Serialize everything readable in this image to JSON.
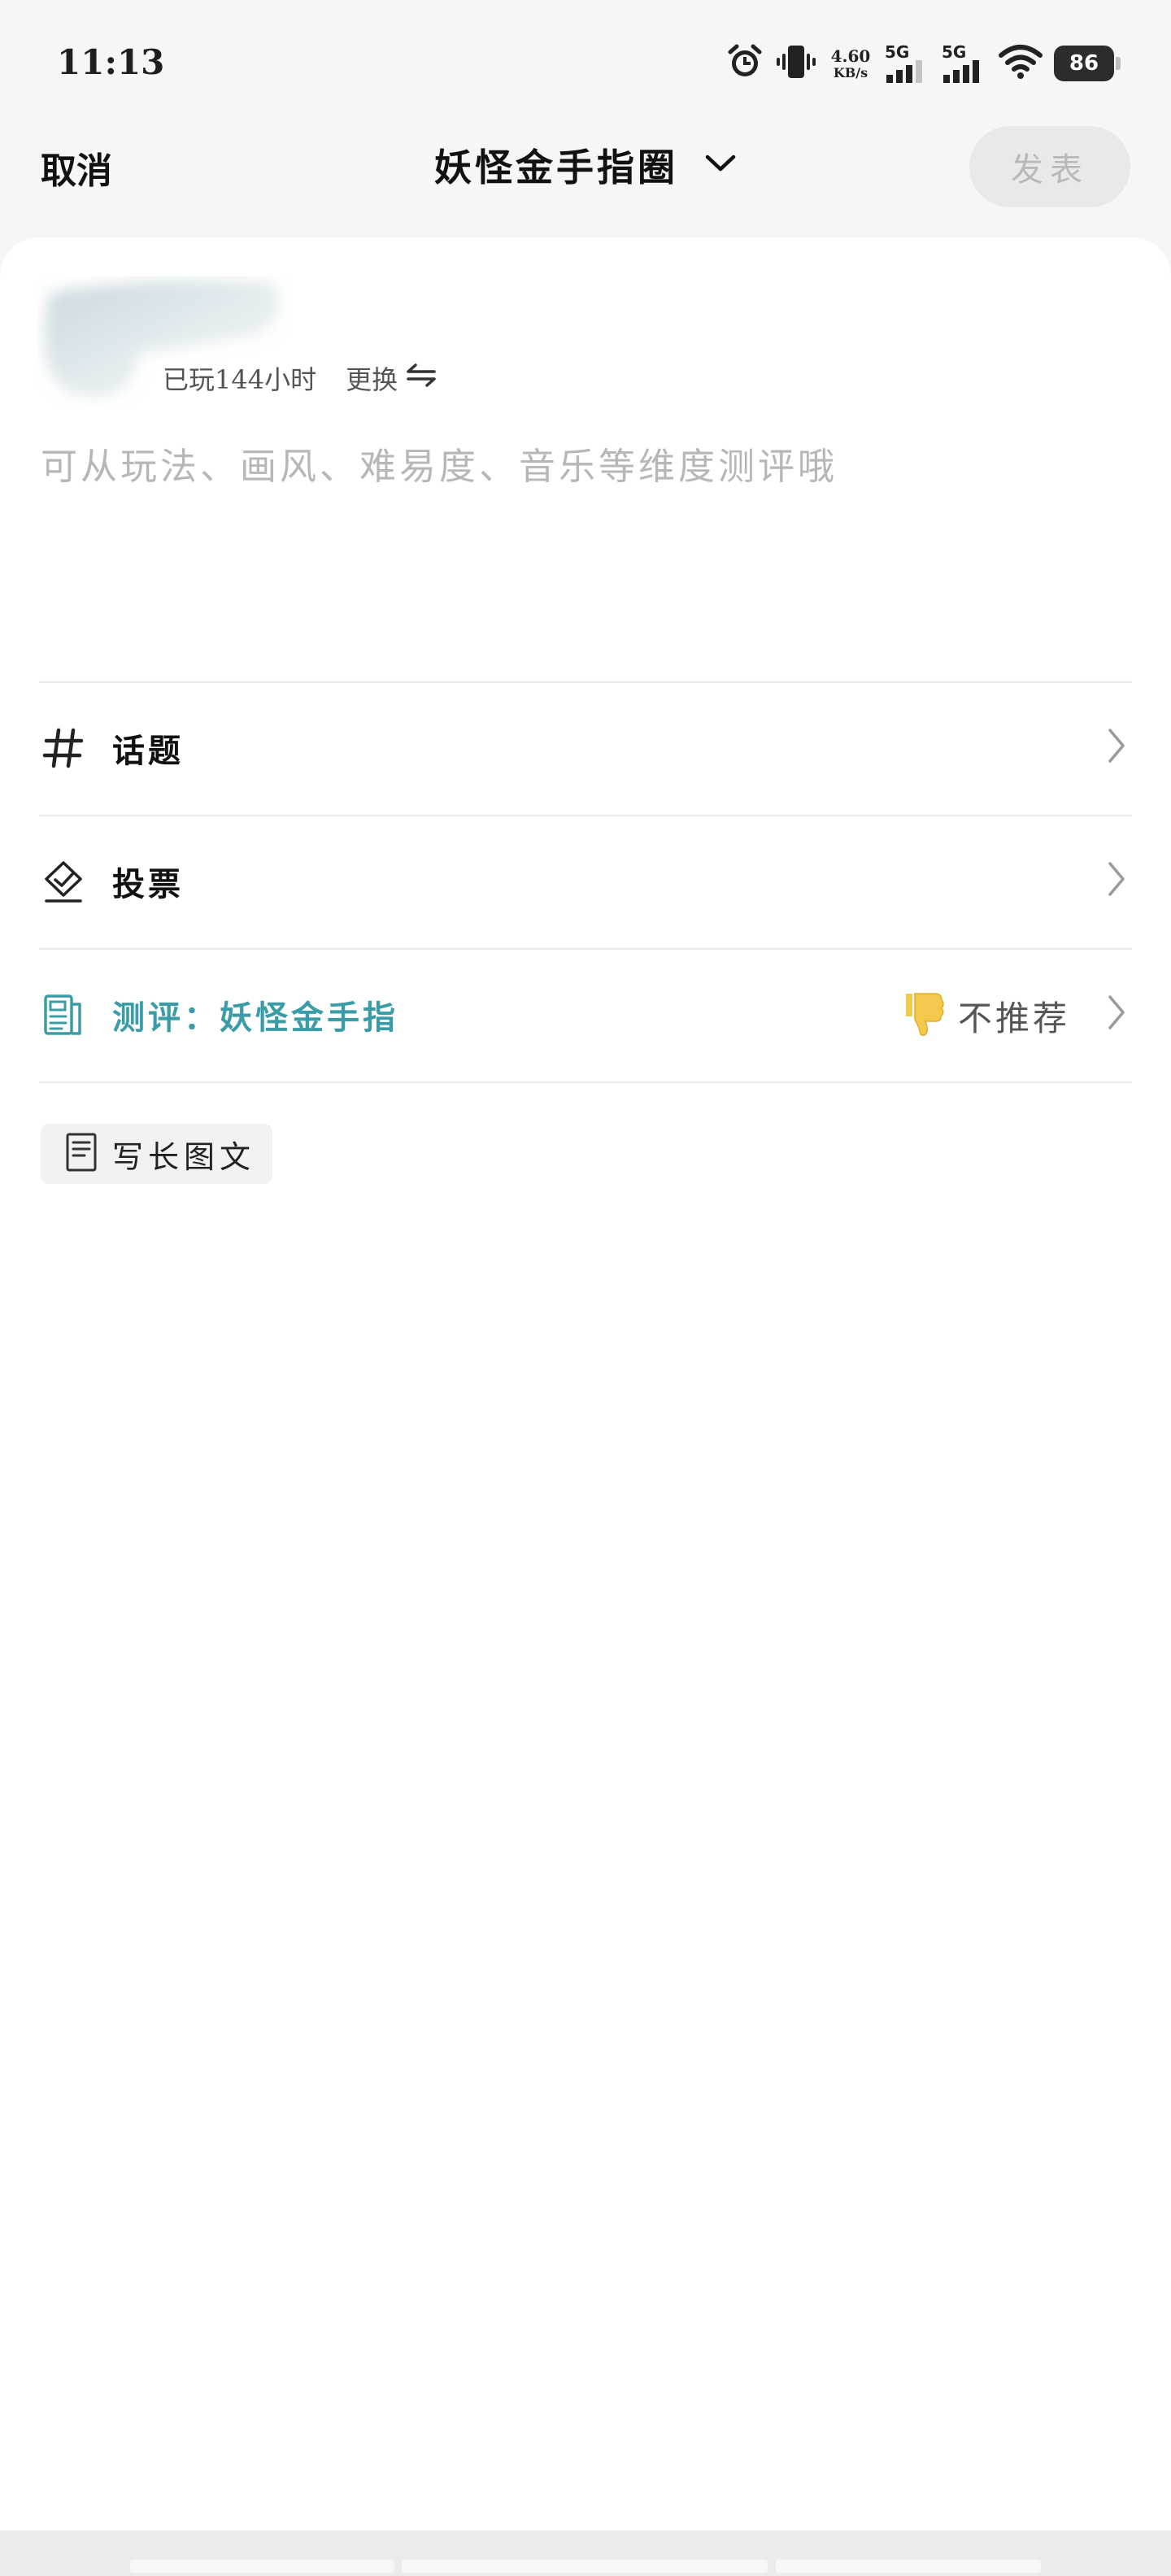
{
  "status": {
    "time": "11:13",
    "net_speed_value": "4.60",
    "net_speed_unit": "KB/s",
    "sim1_label": "5G",
    "sim2_label": "5G",
    "battery": "86"
  },
  "header": {
    "cancel_label": "取消",
    "title": "妖怪金手指圈",
    "publish_label": "发表"
  },
  "composer": {
    "played_time": "已玩144小时",
    "swap_label": "更换",
    "placeholder": "可从玩法、画风、难易度、音乐等维度测评哦"
  },
  "options": {
    "topic_label": "话题",
    "vote_label": "投票",
    "review_label": "测评：妖怪金手指",
    "rating_label": "不推荐"
  },
  "long_post_label": "写长图文",
  "colors": {
    "accent": "#3a9ca6",
    "thumb": "#f2c94c",
    "publish_disabled_bg": "#e9e9e9"
  }
}
